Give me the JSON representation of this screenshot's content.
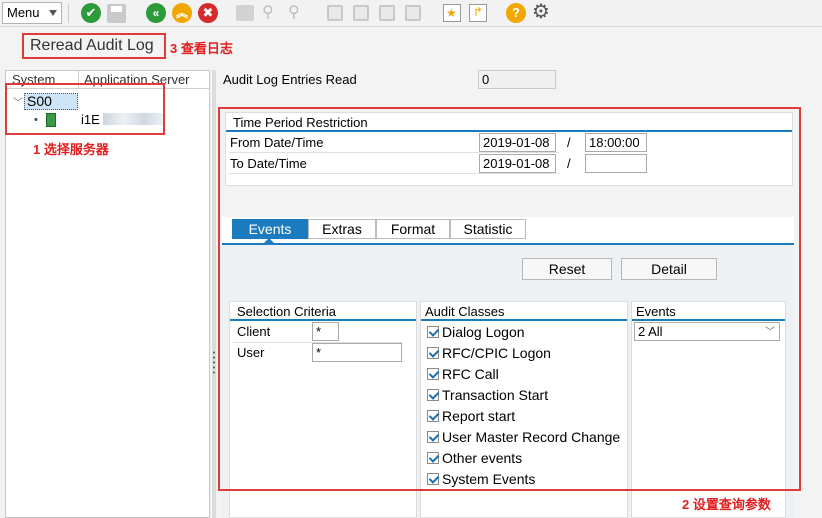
{
  "toolbar": {
    "menu_label": "Menu",
    "icons": [
      "save-check-icon",
      "save-disk-icon",
      "back-icon",
      "exit-icon",
      "cancel-icon",
      "print-icon",
      "find-icon",
      "find-next-icon",
      "first-page-icon",
      "prev-page-icon",
      "next-page-icon",
      "last-page-icon",
      "bookmark-icon",
      "new-session-icon",
      "help-icon",
      "settings-icon"
    ],
    "colors": {
      "green": "#2e9b3a",
      "amber": "#f2a600",
      "red": "#d62b2b",
      "gray": "#c8c8c8"
    }
  },
  "header": {
    "reread_label": "Reread Audit Log",
    "annotation_3": "3 查看日志"
  },
  "tree": {
    "col_system": "System",
    "col_app_server": "Application Server",
    "system_node": "S00",
    "server_node": "i1E",
    "annotation_1": "1 选择服务器"
  },
  "summary": {
    "entries_label": "Audit Log Entries Read",
    "entries_value": "0"
  },
  "time_period": {
    "title": "Time Period Restriction",
    "from_label": "From Date/Time",
    "from_date": "2019-01-08",
    "from_time": "18:00:00",
    "to_label": "To Date/Time",
    "to_date": "2019-01-08",
    "to_time": "",
    "separator": "/"
  },
  "tabs": [
    "Events",
    "Extras",
    "Format",
    "Statistic"
  ],
  "buttons": {
    "reset": "Reset",
    "detail": "Detail"
  },
  "selection": {
    "title": "Selection Criteria",
    "client_label": "Client",
    "client_value": "*",
    "user_label": "User",
    "user_value": "*"
  },
  "audit_classes": {
    "title": "Audit Classes",
    "items": [
      "Dialog Logon",
      "RFC/CPIC Logon",
      "RFC Call",
      "Transaction Start",
      "Report start",
      "User Master Record Change",
      "Other events",
      "System Events"
    ]
  },
  "events": {
    "title": "Events",
    "selected": "2 All"
  },
  "annotation_2": "2 设置查询参数",
  "accent": "#1b7bbf",
  "annotation_color": "#e02020"
}
